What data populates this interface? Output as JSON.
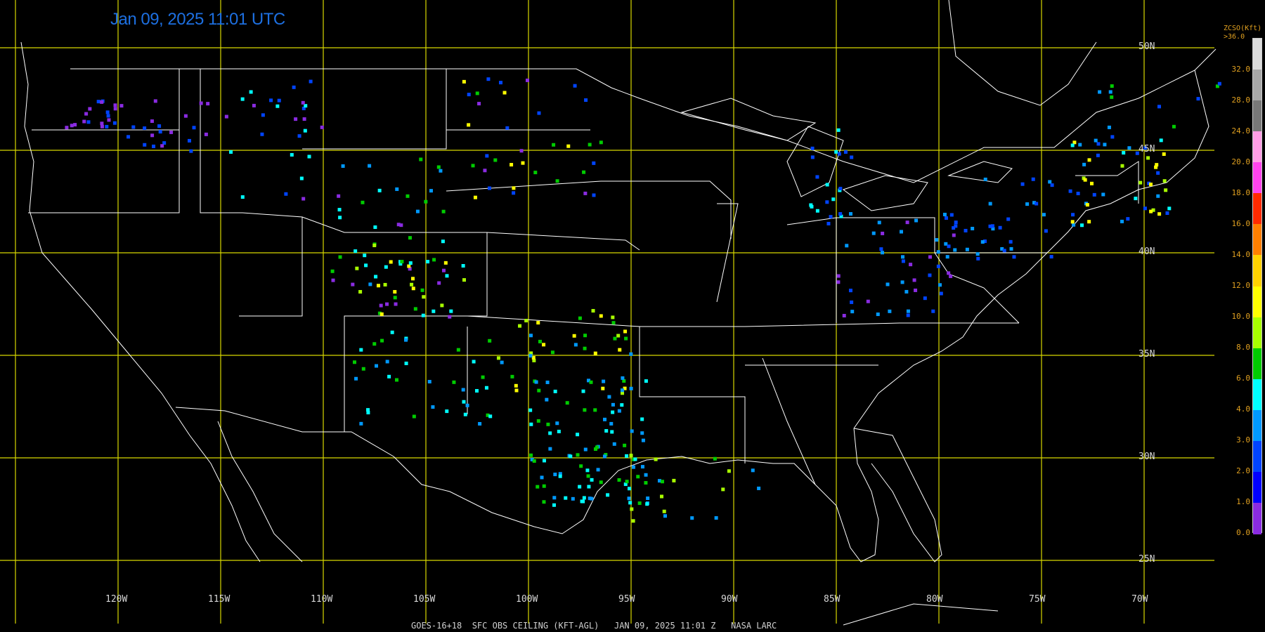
{
  "title": "Jan 09, 2025 11:01 UTC",
  "footer": "GOES-16+18  SFC OBS CEILING (KFT-AGL)   JAN 09, 2025 11:01 Z   NASA LARC",
  "legend": {
    "title_line1": "ZCSO(Kft)",
    "title_line2": ">36.0",
    "labels": [
      "32.0",
      "28.0",
      "24.0",
      "20.0",
      "18.0",
      "16.0",
      "14.0",
      "12.0",
      "10.0",
      "8.0",
      "6.0",
      "4.0",
      "3.0",
      "2.0",
      "1.0",
      "0.0"
    ],
    "colors": [
      "#dcdcdc",
      "#a8a8a8",
      "#787878",
      "#ff9ee6",
      "#ff44ee",
      "#ff2a00",
      "#ff7f00",
      "#ffd200",
      "#ffff00",
      "#a8ff00",
      "#00cc00",
      "#00ffff",
      "#0099ff",
      "#0044ff",
      "#0000ff",
      "#8a2be2"
    ]
  },
  "grid_lines_color": "#d8d800",
  "map_lines_color": "#ffffff",
  "lat_labels": [
    "50N",
    "45N",
    "40N",
    "35N",
    "30N",
    "25N"
  ],
  "lon_labels": [
    "120W",
    "115W",
    "110W",
    "105W",
    "100W",
    "95W",
    "90W",
    "85W",
    "80W",
    "75W",
    "70W"
  ]
}
